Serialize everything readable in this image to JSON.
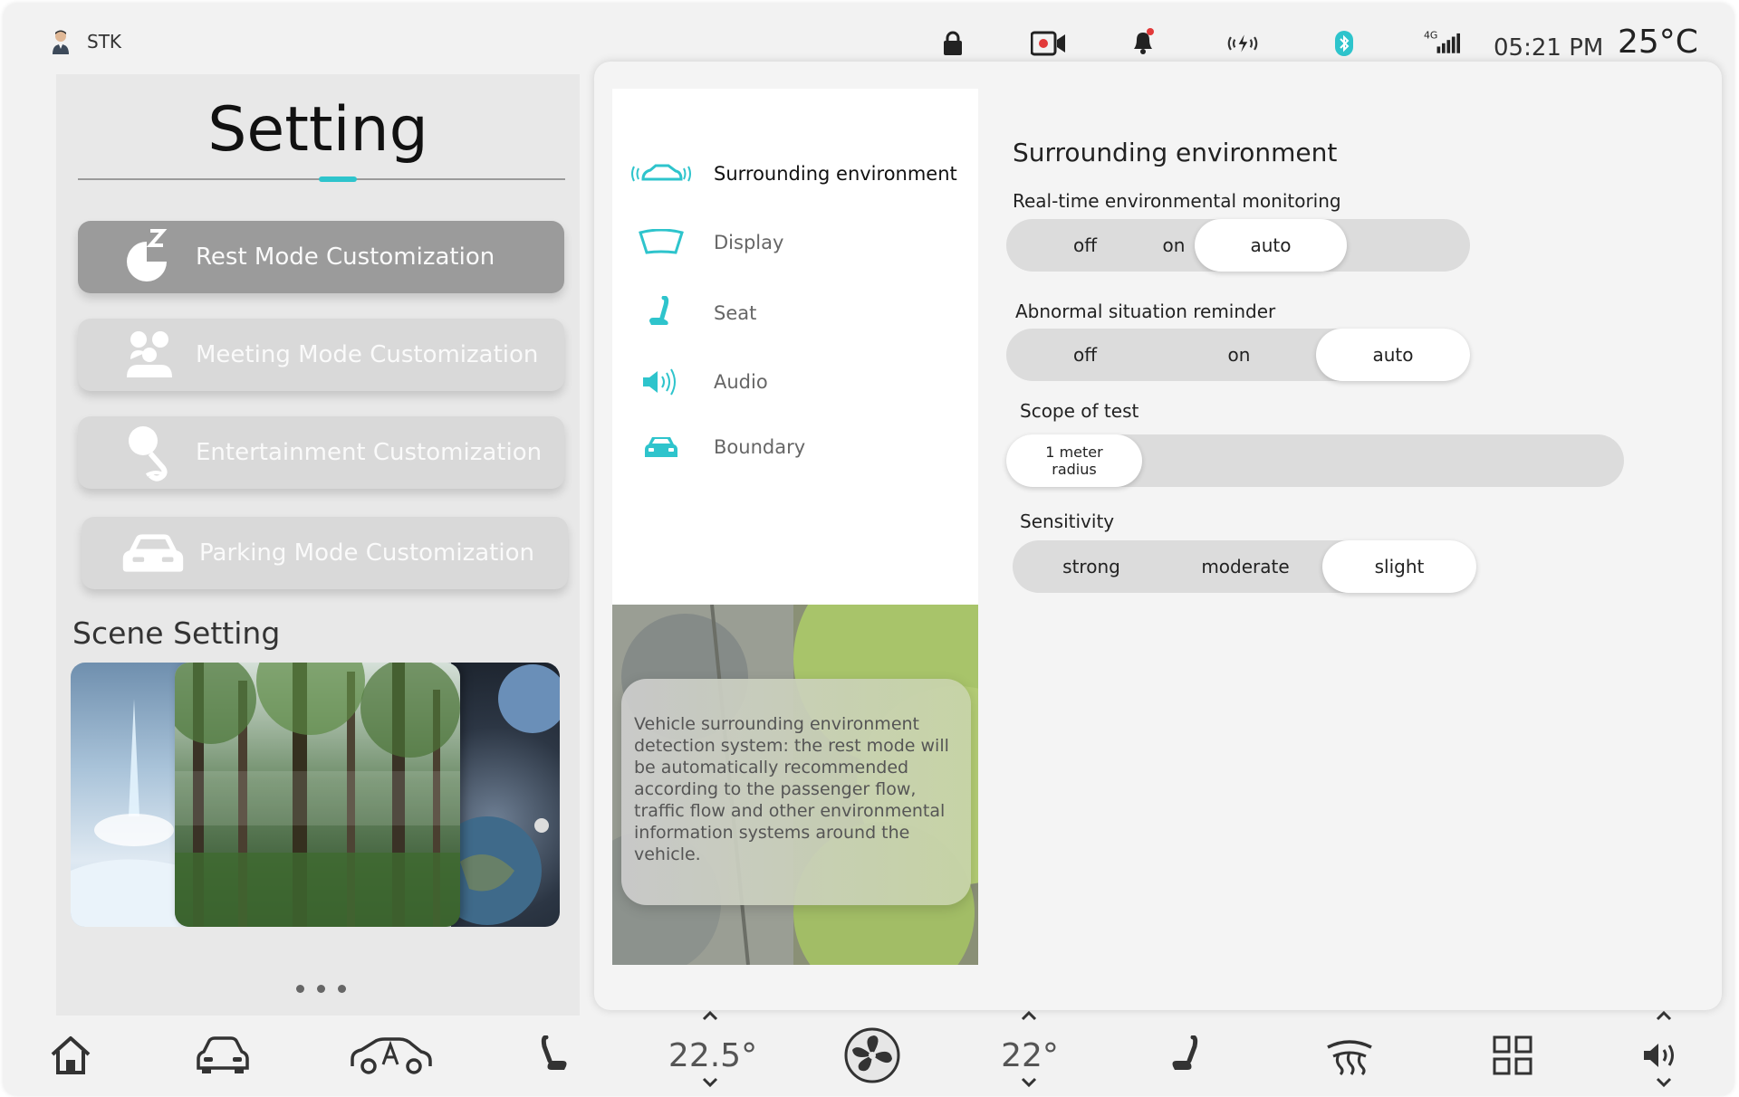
{
  "status_bar": {
    "user_name": "STK",
    "network": "4G",
    "time": "05:21 PM",
    "temperature": "25°C",
    "icons": [
      "user-avatar-icon",
      "lock-icon",
      "camera-icon",
      "bell-icon",
      "wireless-charge-icon",
      "bluetooth-icon",
      "signal-icon"
    ]
  },
  "left_panel": {
    "title": "Setting",
    "modes": [
      {
        "label": "Rest Mode Customization",
        "icon": "sleep-icon",
        "active": true
      },
      {
        "label": "Meeting Mode Customization",
        "icon": "meeting-icon",
        "active": false
      },
      {
        "label": "Entertainment Customization",
        "icon": "microphone-icon",
        "active": false
      },
      {
        "label": "Parking Mode Customization",
        "icon": "car-front-icon",
        "active": false
      }
    ],
    "scene_title": "Scene Setting"
  },
  "menu": {
    "items": [
      {
        "label": "Surrounding environment",
        "icon": "car-radar-icon",
        "active": true
      },
      {
        "label": "Display",
        "icon": "windshield-icon",
        "active": false
      },
      {
        "label": "Seat",
        "icon": "seat-icon",
        "active": false
      },
      {
        "label": "Audio",
        "icon": "speaker-icon",
        "active": false
      },
      {
        "label": "Boundary",
        "icon": "car-boundary-icon",
        "active": false
      }
    ]
  },
  "promo": {
    "text": "Vehicle surrounding environment detection system: the rest mode will be automatically recommended according to the passenger flow, traffic flow and other environmental information systems around the vehicle."
  },
  "settings": {
    "section_title": "Surrounding environment",
    "monitoring": {
      "label": "Real-time environmental monitoring",
      "options": [
        "off",
        "on",
        "auto"
      ],
      "selected": "auto"
    },
    "reminder": {
      "label": "Abnormal situation reminder",
      "options": [
        "off",
        "on",
        "auto"
      ],
      "selected": "auto"
    },
    "scope": {
      "label": "Scope of test",
      "line1": "1 meter",
      "line2": "radius"
    },
    "sensitivity": {
      "label": "Sensitivity",
      "options": [
        "strong",
        "moderate",
        "slight"
      ],
      "selected": "slight"
    }
  },
  "dock": {
    "left_temp": "22.5°",
    "right_temp": "22°",
    "icons": [
      "home-icon",
      "car-icon",
      "auto-drive-icon",
      "seat-left-icon",
      "fan-icon",
      "seat-right-icon",
      "defrost-icon",
      "apps-grid-icon",
      "volume-icon"
    ]
  },
  "colors": {
    "accent": "#2EC4CC",
    "active_mode": "#9B9B9B",
    "inactive_mode": "#D9D9D9",
    "panel": "#F4F4F4"
  }
}
